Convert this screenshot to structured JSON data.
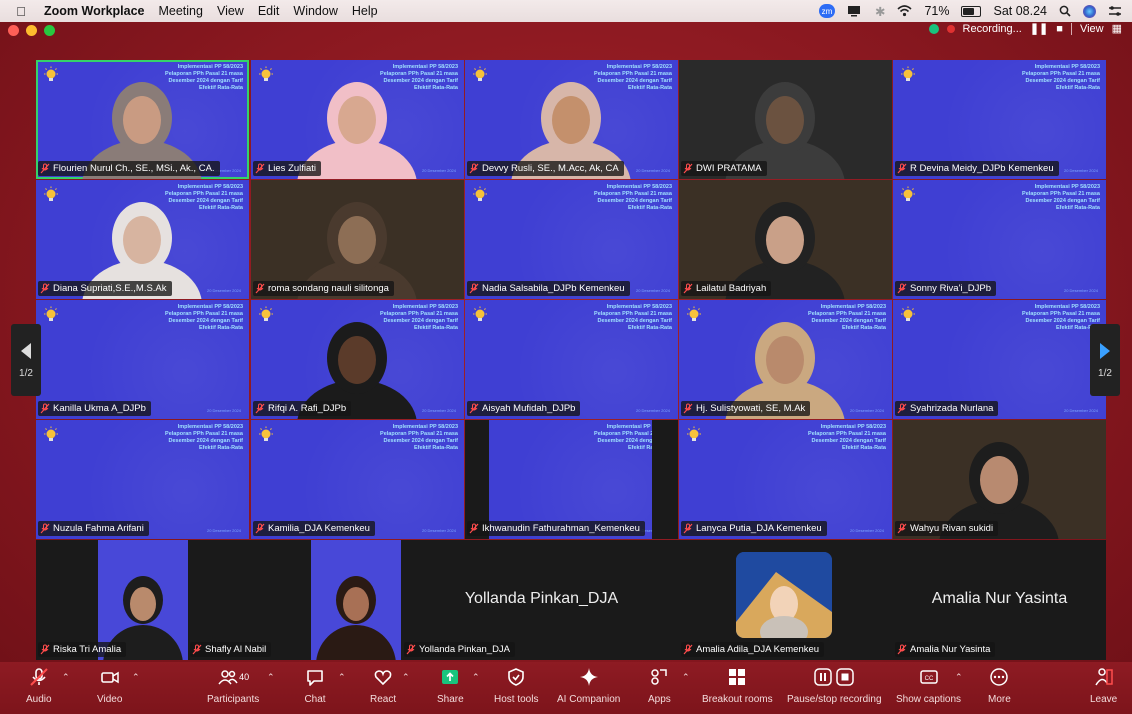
{
  "menubar": {
    "app_name": "Zoom Workplace",
    "items": [
      "Meeting",
      "View",
      "Edit",
      "Window",
      "Help"
    ],
    "battery": "71%",
    "clock": "Sat 08.24",
    "battery_level": 0.71
  },
  "window": {
    "recording_label": "Recording...",
    "view_label": "View"
  },
  "slide_text": "Implementasi PP 58/2023 Pelaporan PPh Pasal 21 masa Desember 2024 dengan Tarif Efektif Rata-Rata",
  "slide_date": "20 Desember 2024",
  "pagination": {
    "left": "1/2",
    "right": "1/2"
  },
  "participants": [
    {
      "name": "Flourien Nurul Ch., SE., MSi., Ak., CA."
    },
    {
      "name": "Lies Zulfiati"
    },
    {
      "name": "Devvy Rusli, SE., M.Acc, Ak, CA"
    },
    {
      "name": "DWI PRATAMA"
    },
    {
      "name": "R Devina Meidy_DJPb Kemenkeu"
    },
    {
      "name": "Diana Supriati,S.E.,M.S.Ak"
    },
    {
      "name": "roma sondang nauli silitonga"
    },
    {
      "name": "Nadia Salsabila_DJPb Kemenkeu"
    },
    {
      "name": "Lailatul Badriyah"
    },
    {
      "name": "Sonny Riva'i_DJPb"
    },
    {
      "name": "Kanilla Ukma A_DJPb"
    },
    {
      "name": "Rifqi A. Rafi_DJPb"
    },
    {
      "name": "Aisyah Mufidah_DJPb"
    },
    {
      "name": "Hj. Sulistyowati, SE, M.Ak"
    },
    {
      "name": "Syahrizada Nurlana"
    },
    {
      "name": "Nuzula Fahma Arifani"
    },
    {
      "name": "Kamilia_DJA Kemenkeu"
    },
    {
      "name": "Ikhwanudin Fathurahman_Kemenkeu"
    },
    {
      "name": "Lanyca Putia_DJA Kemenkeu"
    },
    {
      "name": "Wahyu Rivan sukidi"
    },
    {
      "name": "Riska Tri Amalia"
    },
    {
      "name": "Shafly Al Nabil"
    },
    {
      "name": "Yollanda Pinkan_DJA",
      "big_label": "Yollanda Pinkan_DJA"
    },
    {
      "name": "Amalia Adila_DJA Kemenkeu"
    },
    {
      "name": "Amalia Nur Yasinta",
      "big_label": "Amalia Nur Yasinta"
    }
  ],
  "toolbar": {
    "audio": "Audio",
    "video": "Video",
    "participants": "Participants",
    "participants_count": "40",
    "chat": "Chat",
    "react": "React",
    "share": "Share",
    "host_tools": "Host tools",
    "ai_companion": "AI Companion",
    "apps": "Apps",
    "breakout": "Breakout rooms",
    "recording": "Pause/stop recording",
    "captions": "Show captions",
    "more": "More",
    "leave": "Leave"
  },
  "colors": {
    "zoom_red": "#8c1a22",
    "slide_blue": "#3f3fd3",
    "active_green": "#35d26a",
    "share_green": "#19c37d"
  }
}
